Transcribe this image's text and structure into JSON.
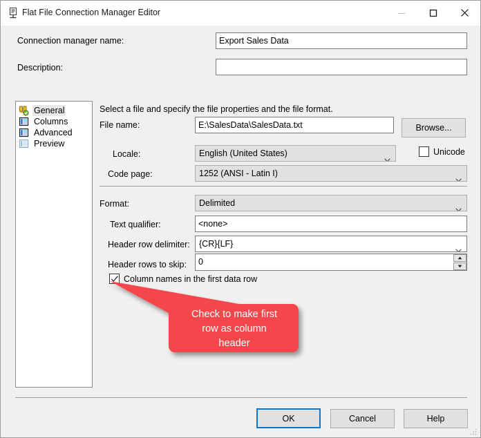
{
  "window": {
    "title": "Flat File Connection Manager Editor",
    "icon": "flat-file-connection-icon",
    "controls": {
      "minimize": "minimize-icon",
      "maximize": "maximize-icon",
      "close": "close-icon"
    }
  },
  "top_form": {
    "connection_manager_name_label": "Connection manager name:",
    "connection_manager_name_value": "Export Sales Data",
    "description_label": "Description:",
    "description_value": ""
  },
  "pages": {
    "items": [
      {
        "label": "General",
        "icon": "general-page-icon",
        "selected": true
      },
      {
        "label": "Columns",
        "icon": "columns-page-icon",
        "selected": false
      },
      {
        "label": "Advanced",
        "icon": "advanced-page-icon",
        "selected": false
      },
      {
        "label": "Preview",
        "icon": "preview-page-icon",
        "selected": false
      }
    ]
  },
  "general_page": {
    "intro_text": "Select a file and specify the file properties and the file format.",
    "file_name_label": "File name:",
    "file_name_value": "E:\\SalesData\\SalesData.txt",
    "browse_label": "Browse...",
    "locale_label": "Locale:",
    "locale_value": "English (United States)",
    "unicode_label": "Unicode",
    "unicode_checked": false,
    "code_page_label": "Code page:",
    "code_page_value": "1252  (ANSI - Latin I)",
    "format_label": "Format:",
    "format_value": "Delimited",
    "text_qualifier_label": "Text qualifier:",
    "text_qualifier_value": "<none>",
    "header_row_delimiter_label": "Header row delimiter:",
    "header_row_delimiter_value": "{CR}{LF}",
    "header_rows_to_skip_label": "Header rows to skip:",
    "header_rows_to_skip_value": "0",
    "column_names_label": "Column names in the first data row",
    "column_names_checked": true
  },
  "annotation": {
    "text": "Check to make first\nrow as column\nheader",
    "fill_color": "#F4474B",
    "text_color": "#FFFFFF",
    "points_to": "column-names-checkbox"
  },
  "footer": {
    "ok_label": "OK",
    "cancel_label": "Cancel",
    "help_label": "Help"
  }
}
